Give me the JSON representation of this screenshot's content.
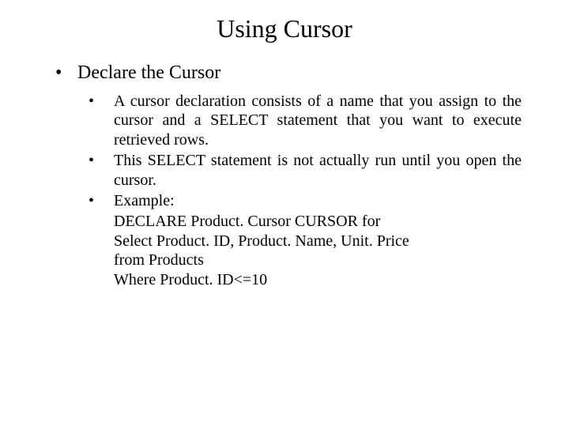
{
  "title": "Using Cursor",
  "section": "Declare the Cursor",
  "points": [
    "A cursor declaration consists of a name that you assign to the cursor and a SELECT statement that you want to execute retrieved rows.",
    "This SELECT statement is not actually run until you open the cursor.",
    "Example:"
  ],
  "example_lines": [
    "DECLARE Product. Cursor CURSOR for",
    "Select Product. ID, Product. Name, Unit. Price",
    "from Products",
    "Where Product. ID<=10"
  ]
}
